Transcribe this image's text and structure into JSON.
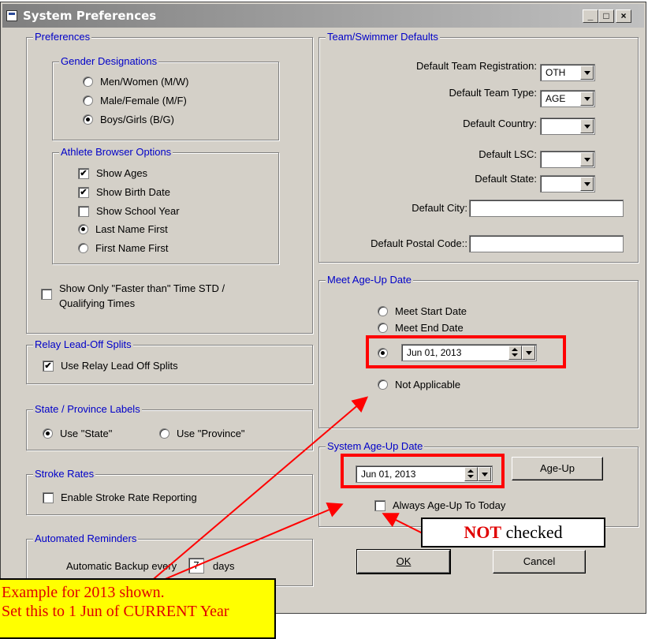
{
  "window": {
    "title": "System Preferences",
    "minimize": "_",
    "maximize": "□",
    "close": "×"
  },
  "preferences": {
    "title": "Preferences",
    "gender": {
      "title": "Gender Designations",
      "options": [
        {
          "label": "Men/Women (M/W)",
          "selected": false
        },
        {
          "label": "Male/Female (M/F)",
          "selected": false
        },
        {
          "label": "Boys/Girls (B/G)",
          "selected": true
        }
      ]
    },
    "athlete": {
      "title": "Athlete Browser Options",
      "show_ages": "Show Ages",
      "show_birth_date": "Show Birth Date",
      "show_school_year": "Show School Year",
      "last_name_first": "Last Name First",
      "first_name_first": "First Name First"
    },
    "faster_than_line1": "Show Only  \"Faster than\" Time STD /",
    "faster_than_line2": "Qualifying Times"
  },
  "relay": {
    "title": "Relay Lead-Off Splits",
    "label": "Use Relay Lead Off Splits"
  },
  "state_labels": {
    "title": "State / Province Labels",
    "state": "Use \"State\"",
    "province": "Use \"Province\""
  },
  "stroke": {
    "title": "Stroke Rates",
    "label": "Enable Stroke Rate Reporting"
  },
  "reminders": {
    "title": "Automated Reminders",
    "label_a": "Automatic Backup every",
    "days_value": "7",
    "label_b": "days"
  },
  "team": {
    "title": "Team/Swimmer Defaults",
    "registration_label": "Default Team Registration:",
    "registration_value": "OTH",
    "type_label": "Default Team Type:",
    "type_value": "AGE",
    "country_label": "Default Country:",
    "lsc_label": "Default LSC:",
    "state_label": "Default State:",
    "city_label": "Default City:",
    "postal_label": "Default Postal Code::"
  },
  "meet_ageup": {
    "title": "Meet Age-Up Date",
    "start": "Meet Start Date",
    "end": "Meet End Date",
    "date_value": "Jun 01, 2013",
    "not_applicable": "Not Applicable"
  },
  "system_ageup": {
    "title": "System Age-Up Date",
    "date_value": "Jun 01, 2013",
    "ageup_button": "Age-Up",
    "always_today": "Always Age-Up To Today"
  },
  "buttons": {
    "ok": "OK",
    "cancel": "Cancel"
  },
  "annotations": {
    "not_checked_bold": "NOT",
    "not_checked_rest": " checked",
    "note_line1": "Example for 2013 shown.",
    "note_line2": "Set this to 1 Jun of CURRENT Year"
  },
  "colors": {
    "annotation_red": "#ff0000",
    "note_yellow": "#ffff00",
    "group_title_blue": "#0000c8"
  }
}
